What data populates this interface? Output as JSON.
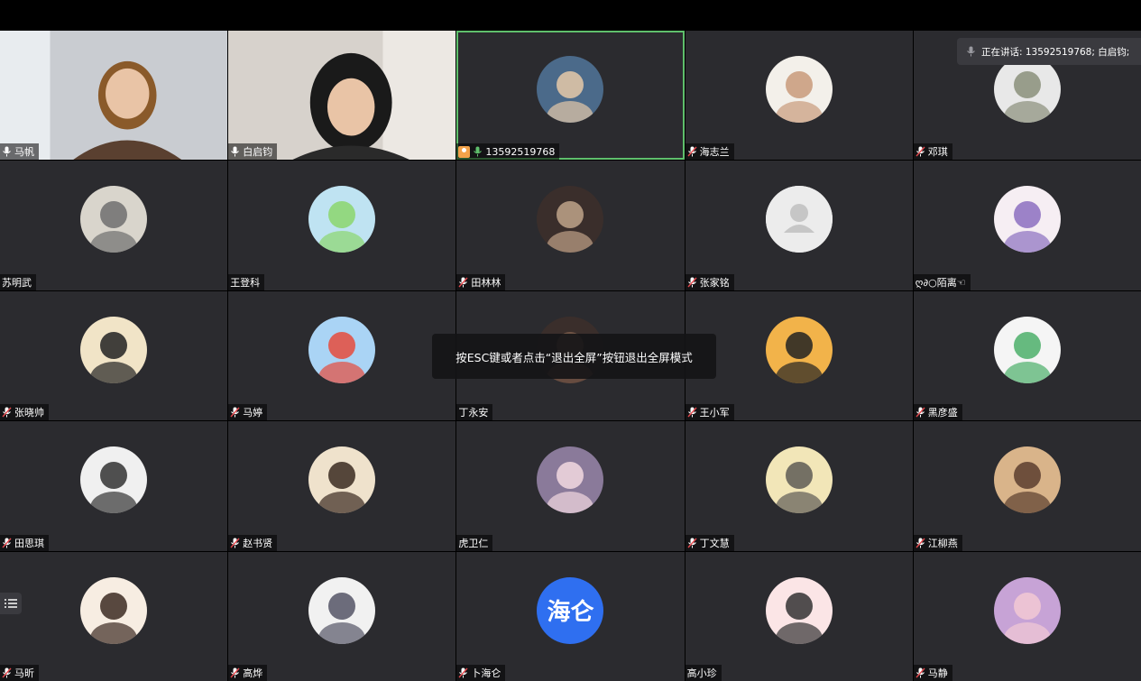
{
  "speaking": {
    "text": "正在讲话: 13592519768; 白启钧;",
    "icon": "mic-icon"
  },
  "toast": {
    "text": "按ESC键或者点击“退出全屏”按钮退出全屏模式"
  },
  "side_toggle": {
    "icon": "list-icon"
  },
  "colors": {
    "active_border": "#5fbf6c",
    "tile_bg": "#2b2b2f",
    "mic_on": "#5fbf6c",
    "avatar_text_bg": "#2f6ff0"
  },
  "participants": [
    {
      "name": "马帆",
      "mic": "on",
      "type": "video"
    },
    {
      "name": "白启钧",
      "mic": "on",
      "type": "video"
    },
    {
      "name": "13592519768",
      "mic": "on-green",
      "type": "avatar",
      "active": true,
      "host": true
    },
    {
      "name": "海志兰",
      "mic": "muted",
      "type": "avatar"
    },
    {
      "name": "邓琪",
      "mic": "muted",
      "type": "avatar"
    },
    {
      "name": "苏明武",
      "mic": "none",
      "type": "avatar"
    },
    {
      "name": "王登科",
      "mic": "none",
      "type": "avatar"
    },
    {
      "name": "田林林",
      "mic": "muted",
      "type": "avatar"
    },
    {
      "name": "张家铭",
      "mic": "muted",
      "type": "default"
    },
    {
      "name": "ღ∂○陌离☜",
      "mic": "none",
      "type": "avatar"
    },
    {
      "name": "张晓帅",
      "mic": "muted",
      "type": "avatar"
    },
    {
      "name": "马婷",
      "mic": "muted",
      "type": "avatar"
    },
    {
      "name": "丁永安",
      "mic": "none",
      "type": "avatar"
    },
    {
      "name": "王小军",
      "mic": "muted",
      "type": "avatar"
    },
    {
      "name": "黑彦盛",
      "mic": "muted",
      "type": "avatar"
    },
    {
      "name": "田思琪",
      "mic": "muted",
      "type": "avatar"
    },
    {
      "name": "赵书贤",
      "mic": "muted",
      "type": "avatar"
    },
    {
      "name": "虎卫仁",
      "mic": "none",
      "type": "avatar"
    },
    {
      "name": "丁文慧",
      "mic": "muted",
      "type": "avatar"
    },
    {
      "name": "江柳燕",
      "mic": "muted",
      "type": "avatar"
    },
    {
      "name": "马昕",
      "mic": "muted",
      "type": "avatar"
    },
    {
      "name": "高烨",
      "mic": "muted",
      "type": "avatar"
    },
    {
      "name": "卜海仑",
      "mic": "muted",
      "type": "text",
      "avatar_text": "海仑"
    },
    {
      "name": "高小珍",
      "mic": "none",
      "type": "avatar"
    },
    {
      "name": "马静",
      "mic": "muted",
      "type": "avatar"
    }
  ]
}
